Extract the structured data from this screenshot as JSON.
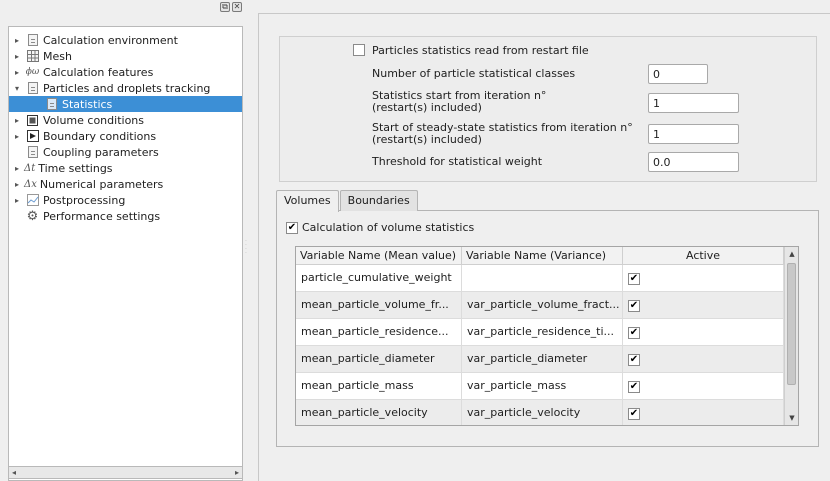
{
  "tree": {
    "items": [
      {
        "label": "Calculation environment",
        "arrow": "▸",
        "icon": "document-icon"
      },
      {
        "label": "Mesh",
        "arrow": "▸",
        "icon": "mesh-icon"
      },
      {
        "label": "Calculation features",
        "arrow": "▸",
        "icon": "phi-icon",
        "glyph": "ϕω"
      },
      {
        "label": "Particles and droplets tracking",
        "arrow": "▾",
        "icon": "document-icon"
      },
      {
        "label": "Statistics",
        "arrow": "",
        "icon": "document-icon",
        "selected": true
      },
      {
        "label": "Volume conditions",
        "arrow": "▸",
        "icon": "volume-icon"
      },
      {
        "label": "Boundary conditions",
        "arrow": "▸",
        "icon": "boundary-icon"
      },
      {
        "label": "Coupling parameters",
        "arrow": "",
        "icon": "document-icon"
      },
      {
        "label": "Time settings",
        "arrow": "▸",
        "icon": "delta-t-icon",
        "glyph": "Δt"
      },
      {
        "label": "Numerical parameters",
        "arrow": "▸",
        "icon": "delta-x-icon",
        "glyph": "Δx"
      },
      {
        "label": "Postprocessing",
        "arrow": "▸",
        "icon": "chart-icon"
      },
      {
        "label": "Performance settings",
        "arrow": "",
        "icon": "gear-icon",
        "glyph": "⚙"
      }
    ]
  },
  "statistics": {
    "restart_label": "Particles statistics read from restart file",
    "classes_label": "Number of particle statistical classes",
    "classes_value": "0",
    "start_label_1": "Statistics start from iteration n°",
    "start_label_2": "(restart(s) included)",
    "start_value": "1",
    "steady_label_1": "Start of steady-state statistics from iteration n°",
    "steady_label_2": "(restart(s) included)",
    "steady_value": "1",
    "threshold_label": "Threshold for statistical weight",
    "threshold_value": "0.0"
  },
  "tabs": [
    "Volumes",
    "Boundaries"
  ],
  "volumes": {
    "calc_label": "Calculation of volume statistics",
    "columns": [
      "Variable Name (Mean value)",
      "Variable Name (Variance)",
      "Active"
    ],
    "rows": [
      {
        "mean": "particle_cumulative_weight",
        "variance": "",
        "active": "✔"
      },
      {
        "mean": "mean_particle_volume_fr...",
        "variance": "var_particle_volume_fract...",
        "active": "✔"
      },
      {
        "mean": "mean_particle_residence...",
        "variance": "var_particle_residence_ti...",
        "active": "✔"
      },
      {
        "mean": "mean_particle_diameter",
        "variance": "var_particle_diameter",
        "active": "✔"
      },
      {
        "mean": "mean_particle_mass",
        "variance": "var_particle_mass",
        "active": "✔"
      },
      {
        "mean": "mean_particle_velocity",
        "variance": "var_particle_velocity",
        "active": "✔"
      }
    ]
  },
  "check_mark": "✔",
  "colors": {
    "selection": "#3c8fd6"
  }
}
